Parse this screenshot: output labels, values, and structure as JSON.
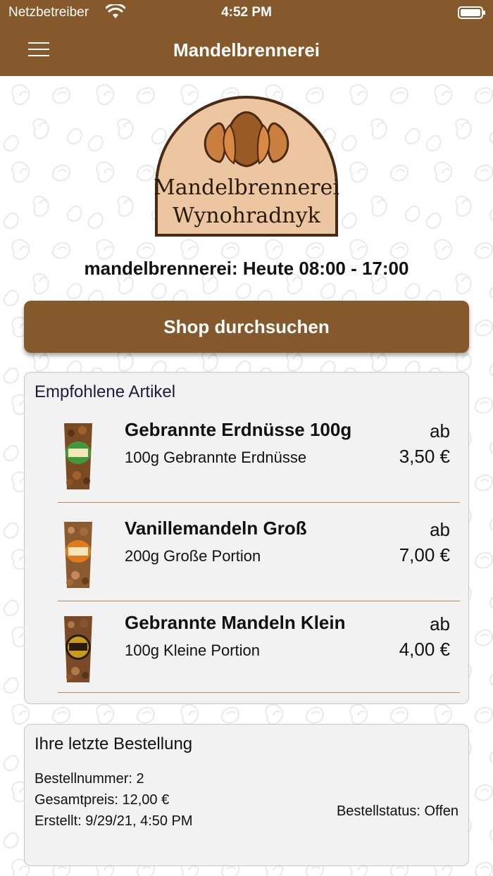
{
  "status_bar": {
    "carrier": "Netzbetreiber",
    "time": "4:52 PM"
  },
  "nav": {
    "title": "Mandelbrennerei"
  },
  "logo": {
    "line1": "Mandelbrennerei",
    "line2": "Wynohradnyk"
  },
  "hours_text": "mandelbrennerei: Heute 08:00 - 17:00",
  "shop_button_label": "Shop durchsuchen",
  "featured": {
    "title": "Empfohlene Artikel",
    "items": [
      {
        "name": "Gebrannte Erdnüsse 100g",
        "description": "100g Gebrannte Erdnüsse",
        "prefix": "ab",
        "price": "3,50 €",
        "label_color": "#3f9a3a"
      },
      {
        "name": "Vanillemandeln Groß",
        "description": "200g Große Portion",
        "prefix": "ab",
        "price": "7,00 €",
        "label_color": "#e07a1c"
      },
      {
        "name": "Gebrannte Mandeln Klein",
        "description": "100g Kleine Portion",
        "prefix": "ab",
        "price": "4,00 €",
        "label_color": "#c89b1a"
      }
    ]
  },
  "last_order": {
    "title": "Ihre letzte Bestellung",
    "order_number": "Bestellnummer: 2",
    "total": "Gesamtpreis: 12,00 €",
    "created": "Erstellt: 9/29/21, 4:50 PM",
    "status": "Bestellstatus: Offen"
  },
  "colors": {
    "brand": "#85592b",
    "card_bg": "#f2f2f2",
    "divider": "#b48a6a"
  },
  "icons": {
    "menu": "hamburger-icon",
    "wifi": "wifi-icon",
    "battery": "battery-icon"
  }
}
